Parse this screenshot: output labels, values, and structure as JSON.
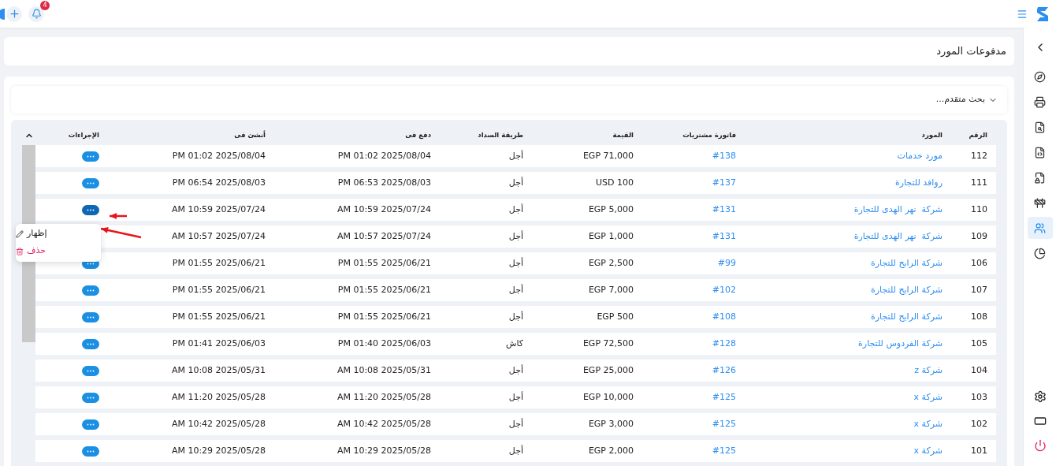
{
  "topbar": {
    "notification_count": "4"
  },
  "page_title": "مدفوعات المورد",
  "advanced_search": {
    "label": "بحث متقدم...",
    "expanded": false
  },
  "table": {
    "columns": [
      "الرقم",
      "المورد",
      "فاتورة مشتريات",
      "القيمة",
      "طريقة السداد",
      "دفع فى",
      "أنشئ فى",
      "الإجراءات"
    ],
    "rows": [
      {
        "number": "112",
        "supplier": "مورد خدمات",
        "invoice": "#138",
        "amount": "EGP 71,000",
        "method": "أجل",
        "paid_at": "PM 01:02 2025/08/04",
        "created_at": "PM 01:02 2025/08/04",
        "menu_open": false
      },
      {
        "number": "111",
        "supplier": "روافد للتجارة",
        "invoice": "#137",
        "amount": "USD 100",
        "method": "أجل",
        "paid_at": "PM 06:53 2025/08/03",
        "created_at": "PM 06:54 2025/08/03",
        "menu_open": false
      },
      {
        "number": "110",
        "supplier": "شركة  نهر الهدى للتجارة",
        "invoice": "#131",
        "amount": "EGP 5,000",
        "method": "أجل",
        "paid_at": "AM 10:59 2025/07/24",
        "created_at": "AM 10:59 2025/07/24",
        "menu_open": true
      },
      {
        "number": "109",
        "supplier": "شركة  نهر الهدى للتجارة",
        "invoice": "#131",
        "amount": "EGP 1,000",
        "method": "أجل",
        "paid_at": "AM 10:57 2025/07/24",
        "created_at": "AM 10:57 2025/07/24",
        "menu_open": false
      },
      {
        "number": "106",
        "supplier": "شركة الرابح للتجارة",
        "invoice": "#99",
        "amount": "EGP 2,500",
        "method": "أجل",
        "paid_at": "PM 01:55 2025/06/21",
        "created_at": "PM 01:55 2025/06/21",
        "menu_open": false
      },
      {
        "number": "107",
        "supplier": "شركة الرابح للتجارة",
        "invoice": "#102",
        "amount": "EGP 7,000",
        "method": "أجل",
        "paid_at": "PM 01:55 2025/06/21",
        "created_at": "PM 01:55 2025/06/21",
        "menu_open": false
      },
      {
        "number": "108",
        "supplier": "شركة الرابح للتجارة",
        "invoice": "#108",
        "amount": "EGP 500",
        "method": "أجل",
        "paid_at": "PM 01:55 2025/06/21",
        "created_at": "PM 01:55 2025/06/21",
        "menu_open": false
      },
      {
        "number": "105",
        "supplier": "شركة الفردوس للتجارة",
        "invoice": "#128",
        "amount": "EGP 72,500",
        "method": "كاش",
        "paid_at": "PM 01:40 2025/06/03",
        "created_at": "PM 01:41 2025/06/03",
        "menu_open": false
      },
      {
        "number": "104",
        "supplier": "شركة z",
        "invoice": "#126",
        "amount": "EGP 25,000",
        "method": "أجل",
        "paid_at": "AM 10:08 2025/05/31",
        "created_at": "AM 10:08 2025/05/31",
        "menu_open": false
      },
      {
        "number": "103",
        "supplier": "شركة x",
        "invoice": "#125",
        "amount": "EGP 10,000",
        "method": "أجل",
        "paid_at": "AM 11:20 2025/05/28",
        "created_at": "AM 11:20 2025/05/28",
        "menu_open": false
      },
      {
        "number": "102",
        "supplier": "شركة x",
        "invoice": "#125",
        "amount": "EGP 3,000",
        "method": "أجل",
        "paid_at": "AM 10:42 2025/05/28",
        "created_at": "AM 10:42 2025/05/28",
        "menu_open": false
      },
      {
        "number": "101",
        "supplier": "شركة x",
        "invoice": "#125",
        "amount": "EGP 2,000",
        "method": "أجل",
        "paid_at": "AM 10:29 2025/05/28",
        "created_at": "AM 10:29 2025/05/28",
        "menu_open": false
      }
    ]
  },
  "row_menu": [
    {
      "kind": "view",
      "label": "إظهار"
    },
    {
      "kind": "delete",
      "label": "حذف"
    }
  ],
  "sidebar": {
    "items": [
      {
        "selected": false
      },
      {
        "selected": false
      },
      {
        "selected": false
      },
      {
        "selected": false
      },
      {
        "selected": false
      },
      {
        "selected": false
      },
      {
        "selected": true
      },
      {
        "selected": false
      }
    ]
  }
}
